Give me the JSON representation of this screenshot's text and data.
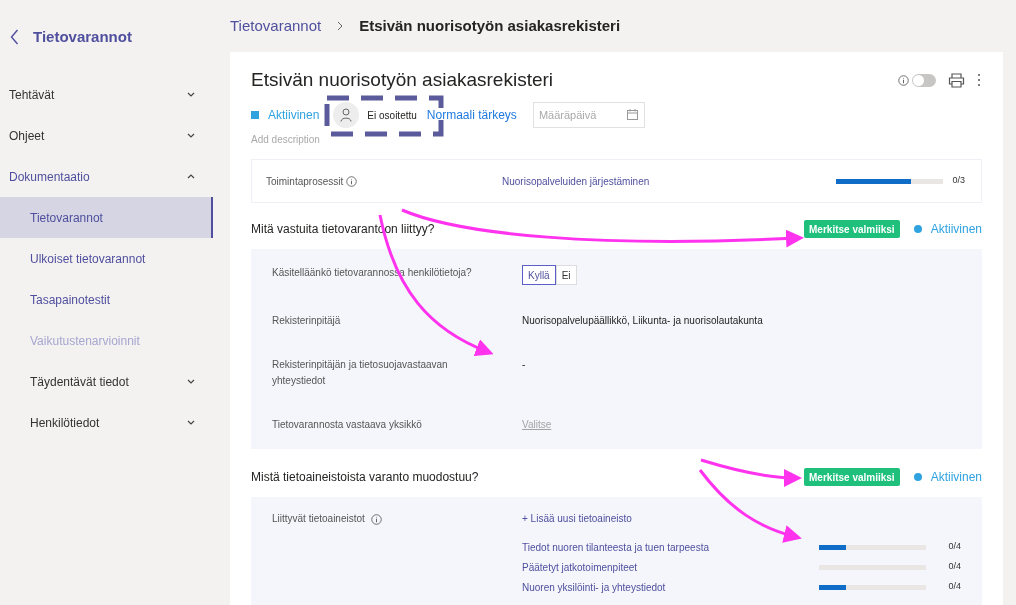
{
  "sidebar": {
    "back_title": "Tietovarannot",
    "items": [
      {
        "label": "Tehtävät",
        "expanded": false,
        "selected": false
      },
      {
        "label": "Ohjeet",
        "expanded": false,
        "selected": false
      },
      {
        "label": "Dokumentaatio",
        "expanded": true,
        "selected": false,
        "children": [
          {
            "label": "Tietovarannot",
            "selected": true,
            "disabled": false
          },
          {
            "label": "Ulkoiset tietovarannot",
            "selected": false,
            "disabled": false
          },
          {
            "label": "Tasapainotestit",
            "selected": false,
            "disabled": false
          },
          {
            "label": "Vaikutustenarvioinnit",
            "selected": false,
            "disabled": true
          },
          {
            "label": "Täydentävät tiedot",
            "selected": false,
            "disabled": false,
            "expanded": false
          },
          {
            "label": "Henkilötiedot",
            "selected": false,
            "disabled": false,
            "expanded": false
          }
        ]
      }
    ]
  },
  "breadcrumb": [
    "Tietovarannot",
    "Etsivän nuorisotyön asiakasrekisteri"
  ],
  "record": {
    "title": "Etsivän nuorisotyön asiakasrekisteri",
    "toggle_on": false,
    "status": {
      "label": "Aktiivinen",
      "color": "#2fa3e0"
    },
    "assignee": "Ei osoitettu",
    "priority": "Normaali tärkeys",
    "due_placeholder": "Määräpäivä",
    "description_placeholder": "Add description",
    "process": {
      "label": "Toimintaprosessit",
      "value": "Nuorisopalveluiden järjestäminen",
      "level": 0.7,
      "count": "0/3"
    }
  },
  "sections": [
    {
      "title": "Mitä vastuita tietovarantoon liittyy?",
      "button": "Merkitse valmiiksi",
      "status": {
        "label": "Aktiivinen",
        "color": "#2fa3e0"
      },
      "rows": [
        {
          "kind": "choice",
          "label": "Käsitelläänkö tietovarannossa henkilötietoja?",
          "options": [
            {
              "label": "Kyllä",
              "selected": true
            },
            {
              "label": "Ei",
              "selected": false
            }
          ]
        },
        {
          "kind": "text",
          "label": "Rekisterinpitäjä",
          "value": "Nuorisopalvelupäällikkö, Liikunta- ja nuorisolautakunta"
        },
        {
          "kind": "text",
          "label": "Rekisterinpitäjän ja tietosuojavastaavan yhteystiedot",
          "value": "-"
        },
        {
          "kind": "link",
          "label": "Tietovarannosta vastaava yksikkö",
          "value": "Valitse"
        }
      ]
    },
    {
      "title": "Mistä tietoaineistoista varanto muodostuu?",
      "button": "Merkitse valmiiksi",
      "status": {
        "label": "Aktiivinen",
        "color": "#2fa3e0"
      },
      "rows": [
        {
          "kind": "datasets",
          "label": "Liittyvät tietoaineistot",
          "add": "+ Lisää uusi tietoaineisto",
          "items": [
            {
              "label": "Tiedot nuoren tilanteesta ja tuen tarpeesta",
              "level": 0.25,
              "count": "0/4"
            },
            {
              "label": "Päätetyt jatkotoimenpiteet",
              "level": 0,
              "count": "0/4"
            },
            {
              "label": "Nuoren yksilöinti- ja yhteystiedot",
              "level": 0.25,
              "count": "0/4"
            }
          ]
        }
      ]
    }
  ]
}
